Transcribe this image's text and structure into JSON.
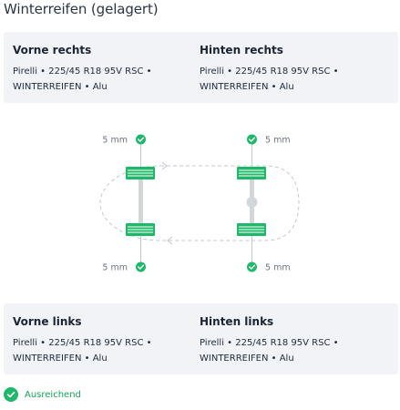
{
  "section_title": "Winterreifen (gelagert)",
  "front_right": {
    "label": "Vorne rechts",
    "spec": "Pirelli • 225/45 R18 95V RSC • WINTERREIFEN • Alu"
  },
  "rear_right": {
    "label": "Hinten rechts",
    "spec": "Pirelli • 225/45 R18 95V RSC • WINTERREIFEN • Alu"
  },
  "front_left": {
    "label": "Vorne links",
    "spec": "Pirelli • 225/45 R18 95V RSC • WINTERREIFEN • Alu"
  },
  "rear_left": {
    "label": "Hinten links",
    "spec": "Pirelli • 225/45 R18 95V RSC • WINTERREIFEN • Alu"
  },
  "tread": {
    "front_right": "5 mm",
    "rear_right": "5 mm",
    "front_left": "5 mm",
    "rear_left": "5 mm"
  },
  "status": {
    "label": "Ausreichend",
    "icon": "check-circle-icon"
  },
  "colors": {
    "accent": "#1fb86a",
    "status_text": "#17a35a",
    "panel": "#f1f3f7"
  }
}
